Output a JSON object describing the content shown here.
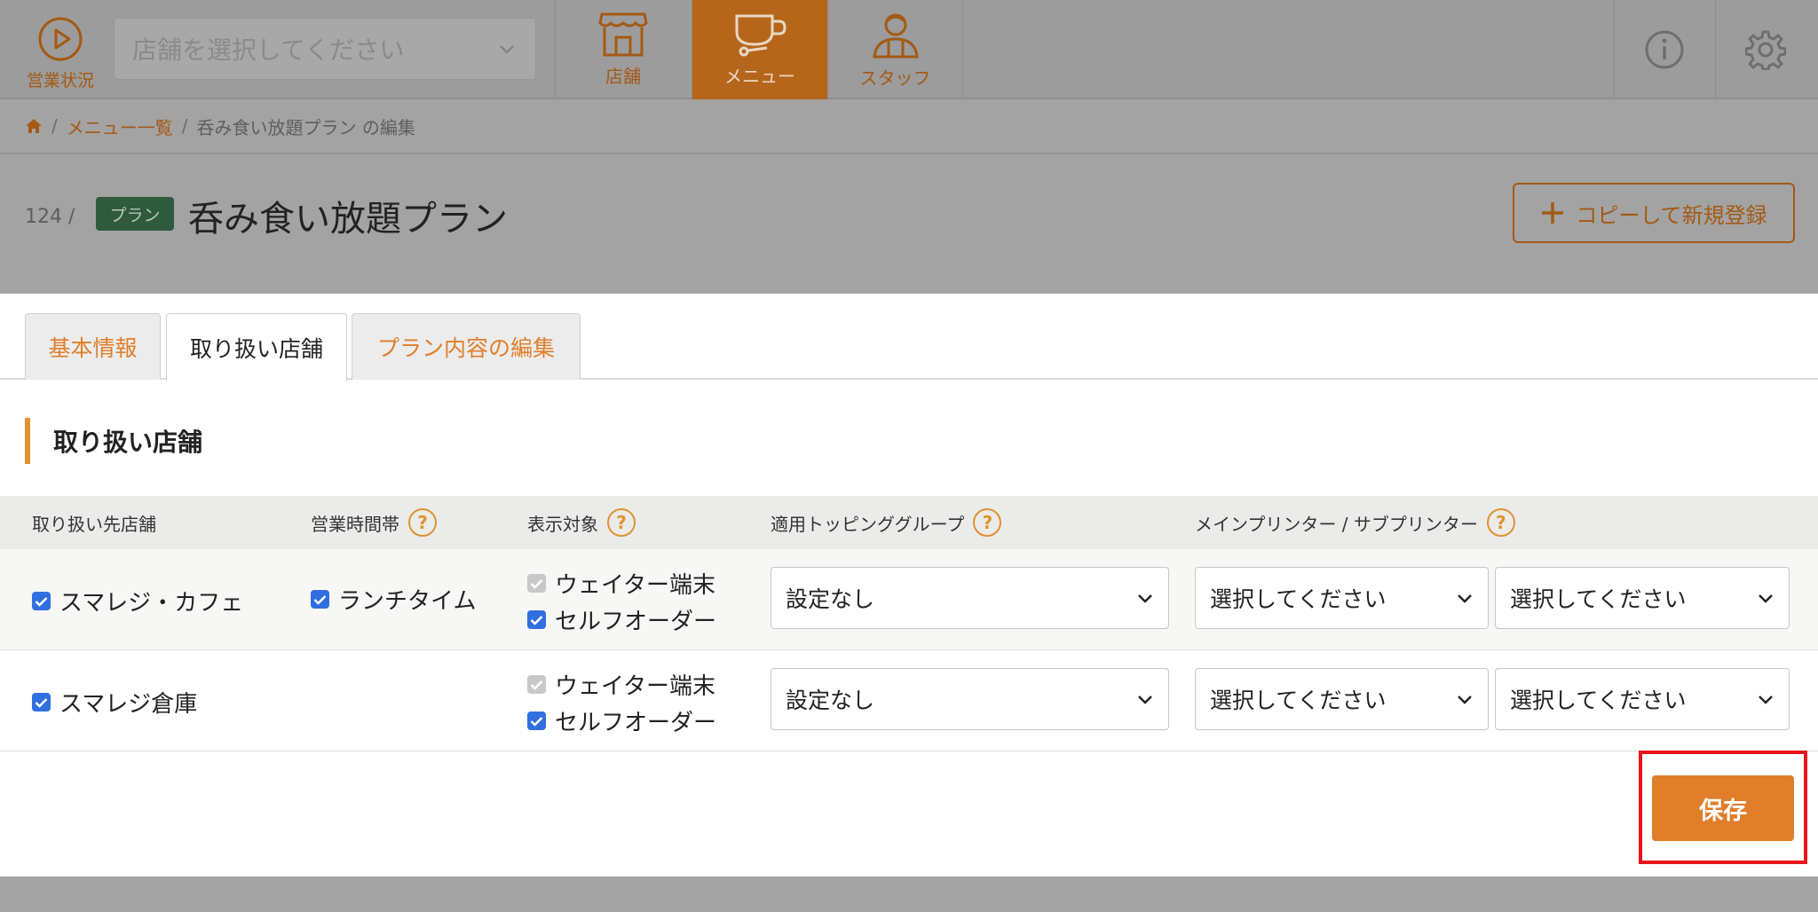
{
  "nav": {
    "status_label": "営業状況",
    "store_select_placeholder": "店舗を選択してください",
    "tabs": [
      {
        "label": "店舗",
        "icon": "storefront-icon"
      },
      {
        "label": "メニュー",
        "icon": "cup-icon",
        "active": true
      },
      {
        "label": "スタッフ",
        "icon": "staff-icon"
      }
    ],
    "info_icon": "info-icon",
    "settings_icon": "gear-icon"
  },
  "breadcrumb": {
    "home_icon": "home-icon",
    "separator": "/",
    "items": [
      "メニュー一覧",
      "呑み食い放題プラン の編集"
    ]
  },
  "header": {
    "id_label": "124 /",
    "badge": "プラン",
    "title": "呑み食い放題プラン",
    "copy_button": "コピーして新規登録"
  },
  "tabs": [
    {
      "label": "基本情報",
      "active": false
    },
    {
      "label": "取り扱い店舗",
      "active": true
    },
    {
      "label": "プラン内容の編集",
      "active": false
    }
  ],
  "section": {
    "title": "取り扱い店舗"
  },
  "table": {
    "headers": {
      "store": "取り扱い先店舗",
      "hours": "営業時間帯",
      "display": "表示対象",
      "topping": "適用トッピンググループ",
      "printer": "メインプリンター / サブプリンター"
    },
    "help_mark": "?",
    "rows": [
      {
        "store": "スマレジ・カフェ",
        "hours": "ランチタイム",
        "display": [
          "ウェイター端末",
          "セルフオーダー"
        ],
        "topping": "設定なし",
        "main_printer": "選択してください",
        "sub_printer": "選択してください"
      },
      {
        "store": "スマレジ倉庫",
        "display": [
          "ウェイター端末",
          "セルフオーダー"
        ],
        "topping": "設定なし",
        "main_printer": "選択してください",
        "sub_printer": "選択してください"
      }
    ]
  },
  "save_button": "保存",
  "colors": {
    "accent": "#e07e2a",
    "badge": "#2f5a3c",
    "checkbox": "#2f6fe0",
    "highlight": "#e8141a"
  }
}
